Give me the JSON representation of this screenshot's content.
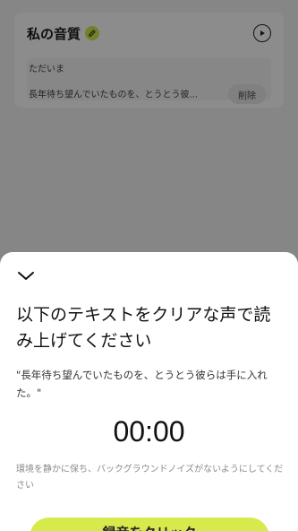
{
  "background": {
    "card_title": "私の音質",
    "card_subtitle": "ただいま",
    "card_sample": "長年待ち望んでいたものを、とうとう彼...",
    "delete_label": "削除",
    "accent_color": "#d6ea4c"
  },
  "sheet": {
    "title": "以下のテキストをクリアな声で読み上げてください",
    "sample_text": "\"長年待ち望んでいたものを、とうとう彼らは手に入れた。\"",
    "timer": "00:00",
    "hint": "環境を静かに保ち、バックグラウンドノイズがないようにしてください",
    "record_button": "録音をクリック"
  }
}
